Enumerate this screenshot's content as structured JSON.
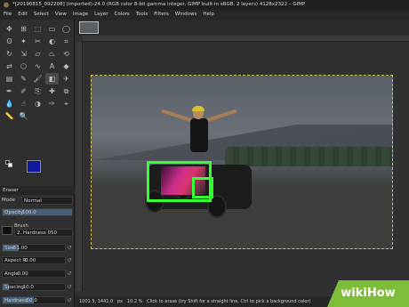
{
  "window": {
    "title": "*[20190815_092208] (imported)-24.0 (RGB color 8-bit gamma integer, GIMP built-in sRGB, 2 layers) 4128x2322 – GIMP"
  },
  "menu": [
    "File",
    "Edit",
    "Select",
    "View",
    "Image",
    "Layer",
    "Colors",
    "Tools",
    "Filters",
    "Windows",
    "Help"
  ],
  "toolbox": {
    "tools": [
      "move",
      "align",
      "free-select",
      "rect-select",
      "ellipse-select",
      "lasso",
      "fuzzy-select",
      "scissors",
      "foreground-select",
      "crop",
      "rotate",
      "scale",
      "shear",
      "perspective",
      "transform",
      "flip",
      "cage",
      "warp",
      "text",
      "bucket",
      "blend",
      "pencil",
      "paintbrush",
      "eraser",
      "airbrush",
      "ink",
      "mypaint",
      "clone",
      "heal",
      "perspective-clone",
      "blur",
      "smudge",
      "dodge",
      "paths",
      "color-picker",
      "measure",
      "zoom"
    ],
    "active_tool": "eraser",
    "fg_color": "#11189e",
    "bg_color": "#ffffff"
  },
  "tool_options": {
    "heading": "Eraser",
    "mode_label": "Mode",
    "mode_value": "Normal",
    "opacity_label": "Opacity",
    "opacity_value": "100.0",
    "opacity_fraction": 1.0,
    "brush_label": "Brush",
    "brush_value": "2. Hardness 050",
    "size_label": "Size",
    "size_value": "51.00",
    "size_fraction": 0.25,
    "aspect_label": "Aspect R",
    "aspect_value": "0.00",
    "angle_label": "Angle",
    "angle_value": "0.00",
    "spacing_label": "Spacing",
    "spacing_value": "10.0",
    "spacing_fraction": 0.1,
    "hardness_label": "Hardness",
    "hardness_value": "50.0",
    "hardness_fraction": 0.5
  },
  "statusbar": {
    "coords": "1001.5, 1441.0",
    "unit": "px",
    "zoom": "10.2 %",
    "message": "Click to erase (try Shift for a straight line, Ctrl to pick a background color)"
  },
  "watermark": {
    "brand": "wikiHow"
  },
  "colors": {
    "selection_highlight": "#33ff33",
    "canvas_border": "#c9c34a",
    "wikihow_green": "#7dbd3a"
  }
}
